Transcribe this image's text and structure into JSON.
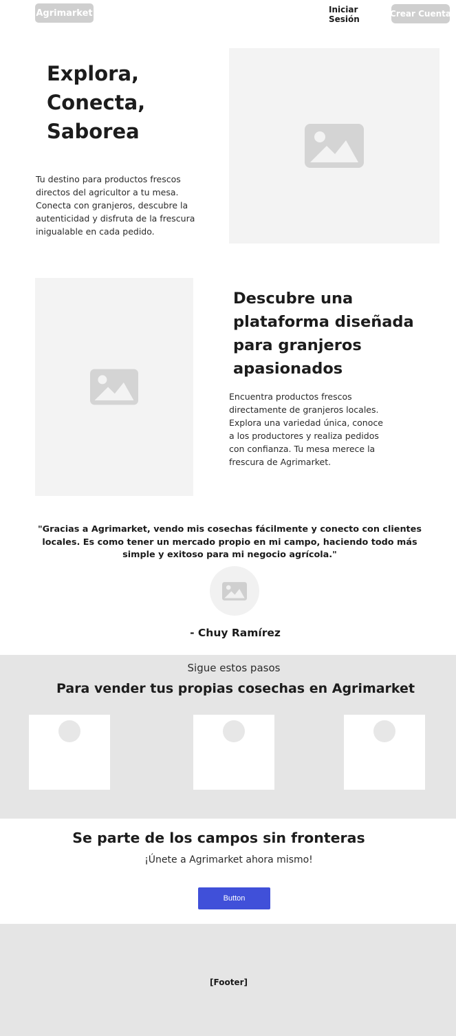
{
  "header": {
    "logo_label": "Agrimarket",
    "login_label": "Iniciar Sesión",
    "signup_label": "Crear Cuenta"
  },
  "hero": {
    "title": "Explora, Conecta, Saborea",
    "description": "Tu destino para productos frescos directos del agricultor a tu mesa. Conecta con granjeros, descubre la autenticidad y disfruta de la  frescura inigualable en cada pedido.",
    "image_icon": "image-icon"
  },
  "feature": {
    "title": "Descubre una plataforma diseñada para granjeros apasionados",
    "description": "Encuentra productos frescos directamente de granjeros locales. Explora una  variedad única, conoce a los productores y realiza pedidos con  confianza. Tu mesa merece la frescura de Agrimarket.",
    "image_icon": "image-icon"
  },
  "testimonial": {
    "quote": "\"Gracias a Agrimarket, vendo mis cosechas fácilmente y conecto con  clientes locales. Es como tener un mercado propio en mi campo, haciendo  todo más simple y exitoso para mi negocio agrícola.\"",
    "author": "- Chuy Ramírez",
    "avatar_icon": "image-icon"
  },
  "steps": {
    "subtitle": "Sigue estos pasos",
    "title": "Para vender tus propias cosechas en Agrimarket",
    "count": 3
  },
  "cta": {
    "title": "Se parte de los campos sin fronteras",
    "subtitle": "¡Únete a Agrimarket ahora mismo!",
    "button_label": "Button",
    "button_color": "#4050d9"
  },
  "footer": {
    "label": "[Footer]"
  },
  "colors": {
    "placeholder_bg": "#f3f3f3",
    "section_bg": "#e5e5e5",
    "header_button_bg": "#cfcfcf"
  }
}
